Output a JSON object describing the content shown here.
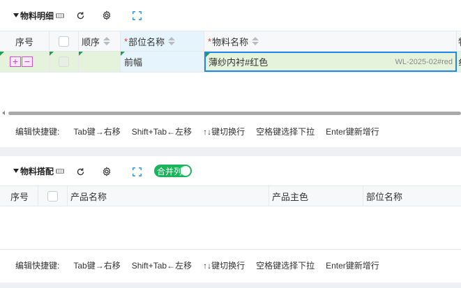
{
  "panel1": {
    "title": "物料明细",
    "columns": {
      "seq": "序号",
      "order": "顺序",
      "part_name": "部位名称",
      "material_name": "物料名称",
      "next": "物"
    },
    "row": {
      "add": "+",
      "remove": "−",
      "part_name": "前幅",
      "material_name": "薄纱内衬#红色",
      "material_code": "WL-2025-02#red",
      "next": "纟"
    }
  },
  "panel2": {
    "title": "物料搭配",
    "merge_toggle": "合并列",
    "columns": {
      "seq": "序号",
      "product_name": "产品名称",
      "main_color": "产品主色",
      "part_name": "部位名称"
    }
  },
  "shortcuts": {
    "label": "编辑快捷键:",
    "items": [
      "Tab键→右移",
      "Shift+Tab←左移",
      "↑↓键切换行",
      "空格键选择下拉",
      "Enter键新增行"
    ]
  },
  "colors": {
    "accent": "#1e88e5",
    "toggle_on": "#19b55a",
    "required": "#e53935",
    "row_highlight": "#e6f3dc"
  }
}
